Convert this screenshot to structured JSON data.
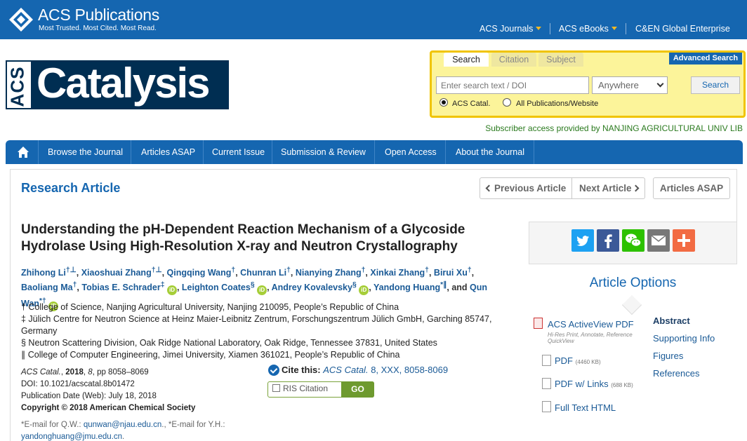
{
  "header": {
    "brand_title": "ACS Publications",
    "brand_tagline": "Most Trusted. Most Cited. Most Read.",
    "nav": [
      {
        "label": "ACS Journals"
      },
      {
        "label": "ACS eBooks"
      },
      {
        "label": "C&EN Global Enterprise"
      }
    ]
  },
  "journal": {
    "logo_prefix": "ACS",
    "logo_name": "Catalysis"
  },
  "search": {
    "tabs": [
      "Search",
      "Citation",
      "Subject"
    ],
    "advanced_label": "Advanced Search",
    "placeholder": "Enter search text / DOI",
    "scope_selected": "Anywhere",
    "button_label": "Search",
    "radio_options": [
      "ACS Catal.",
      "All Publications/Website"
    ]
  },
  "subscriber_text": "Subscriber access provided by NANJING AGRICULTURAL UNIV LIB",
  "mainnav": {
    "items": [
      "Browse the Journal",
      "Articles ASAP",
      "Current Issue",
      "Submission & Review",
      "Open Access",
      "About the Journal"
    ]
  },
  "article": {
    "type": "Research Article",
    "prev_label": "Previous Article",
    "next_label": "Next Article",
    "asap_label": "Articles ASAP",
    "title": "Understanding the pH-Dependent Reaction Mechanism of a Glycoside Hydrolase Using High-Resolution X-ray and Neutron Crystallography",
    "authors": [
      {
        "name": "Zhihong Li",
        "sup": "†⊥",
        "sep": ", "
      },
      {
        "name": "Xiaoshuai Zhang",
        "sup": "†⊥",
        "sep": ", "
      },
      {
        "name": "Qingqing Wang",
        "sup": "†",
        "sep": ", "
      },
      {
        "name": "Chunran Li",
        "sup": "†",
        "sep": ", "
      },
      {
        "name": "Nianying Zhang",
        "sup": "†",
        "sep": ", "
      },
      {
        "name": "Xinkai Zhang",
        "sup": "†",
        "sep": ", "
      },
      {
        "name": "Birui Xu",
        "sup": "†",
        "sep": ", "
      },
      {
        "name": "Baoliang Ma",
        "sup": "†",
        "sep": ", "
      },
      {
        "name": "Tobias E. Schrader",
        "sup": "‡",
        "sep": ", "
      },
      {
        "name": "Leighton Coates",
        "sup": "§",
        "sep": ", "
      },
      {
        "name": "Andrey Kovalevsky",
        "sup": "§",
        "sep": ", "
      },
      {
        "name": "Yandong Huang",
        "sup": "*∥",
        "sep": ", and "
      },
      {
        "name": "Qun Wan",
        "sup": "*†",
        "sep": ""
      }
    ],
    "orcid_label": "iD",
    "affiliations": [
      "† College of Science, Nanjing Agricultural University, Nanjing 210095, People’s Republic of China",
      "‡ Jülich Centre for Neutron Science at Heinz Maier-Leibnitz Zentrum, Forschungszentrum Jülich GmbH, Garching 85747, Germany",
      "§ Neutron Scattering Division, Oak Ridge National Laboratory, Oak Ridge, Tennessee 37831, United States",
      "∥ College of Computer Engineering, Jimei University, Xiamen 361021, People’s Republic of China"
    ],
    "citation": {
      "journal": "ACS Catal.",
      "year": "2018",
      "volume": "8",
      "pages": "pp 8058–8069",
      "doi": "DOI: 10.1021/acscatal.8b01472",
      "pub_date": "Publication Date (Web): July 18, 2018",
      "copyright": "Copyright © 2018 American Chemical Society"
    },
    "emails": {
      "prefix1": "*E-mail for Q.W.: ",
      "email1": "qunwan@njau.edu.cn",
      "prefix2": "., *E-mail for Y.H.: ",
      "email2": "yandonghuang@jmu.edu.cn",
      "suffix": "."
    },
    "cite_this": {
      "label": "Cite this:",
      "text": "ACS Catal.",
      "ref": "8, XXX, 8058-8069"
    },
    "ris_label": "RIS Citation",
    "go_label": "GO"
  },
  "sidebar": {
    "share_icons": [
      "twitter-icon",
      "facebook-icon",
      "wechat-icon",
      "email-icon",
      "plus-icon"
    ],
    "share_colors": [
      "#1da1f2",
      "#3b5998",
      "#2dc100",
      "#777777",
      "#f26b43"
    ],
    "options_title": "Article Options",
    "downloads": [
      {
        "label": "ACS ActiveView PDF",
        "note": "Hi-Res Print, Annotate, Reference QuickView"
      },
      {
        "label": "PDF",
        "size": "(4460 KB)"
      },
      {
        "label": "PDF w/ Links",
        "size": "(688 KB)"
      },
      {
        "label": "Full Text HTML"
      }
    ],
    "links": [
      "Abstract",
      "Supporting Info",
      "Figures",
      "References"
    ]
  }
}
